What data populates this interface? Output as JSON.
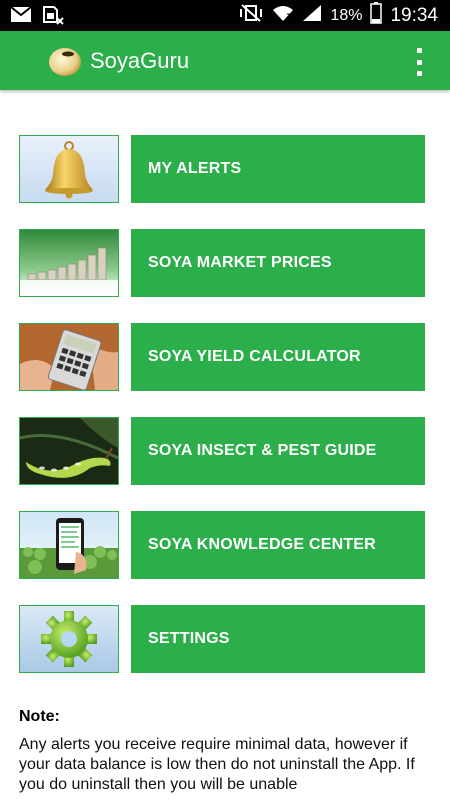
{
  "status_bar": {
    "battery_percent": "18%",
    "time": "19:34",
    "icons": [
      "gmail-icon",
      "sim-card-icon",
      "mute-vibrate-icon",
      "wifi-icon",
      "signal-icon",
      "battery-icon"
    ]
  },
  "app_bar": {
    "title": "SoyaGuru",
    "logo_icon": "soybean-icon",
    "menu_icon": "overflow-menu-icon"
  },
  "menu": [
    {
      "label": "MY ALERTS",
      "image": "bell-image"
    },
    {
      "label": "SOYA MARKET PRICES",
      "image": "coin-stacks-image"
    },
    {
      "label": "SOYA YIELD CALCULATOR",
      "image": "calculator-image"
    },
    {
      "label": "SOYA INSECT & PEST GUIDE",
      "image": "caterpillar-image"
    },
    {
      "label": "SOYA KNOWLEDGE CENTER",
      "image": "phone-field-image"
    },
    {
      "label": "SETTINGS",
      "image": "gear-image"
    }
  ],
  "note": {
    "title": "Note:",
    "body": "Any alerts you receive require minimal data, however if your data balance is low then do not uninstall the App. If you do uninstall then you will be unable"
  },
  "colors": {
    "primary": "#2cae4a",
    "status_bar": "#000000",
    "background": "#ffffff"
  }
}
